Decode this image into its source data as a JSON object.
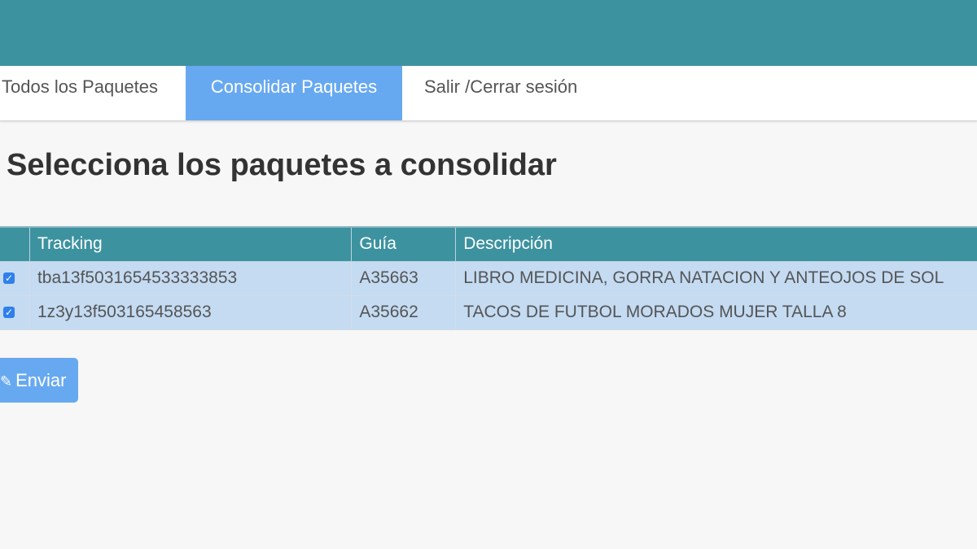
{
  "nav": {
    "items": [
      {
        "label": "Todos los Paquetes"
      },
      {
        "label": "Consolidar Paquetes"
      },
      {
        "label": "Salir /Cerrar sesión"
      }
    ]
  },
  "page": {
    "title": "Selecciona los paquetes a consolidar"
  },
  "table": {
    "headers": [
      "",
      "Tracking",
      "Guía",
      "Descripción"
    ],
    "rows": [
      {
        "checked": true,
        "tracking": "tba13f5031654533333853",
        "guia": "A35663",
        "descripcion": "LIBRO MEDICINA, GORRA NATACION Y ANTEOJOS DE SOL"
      },
      {
        "checked": true,
        "tracking": "1z3y13f503165458563",
        "guia": "A35662",
        "descripcion": "TACOS DE FUTBOL MORADOS MUJER TALLA 8"
      }
    ]
  },
  "actions": {
    "send_label": "Enviar",
    "send_icon": "edit-icon"
  },
  "colors": {
    "topbar": "#3d92a0",
    "active_tab": "#67a9f0",
    "row_bg": "#c4dbf2",
    "header_bg": "#3d92a0"
  }
}
